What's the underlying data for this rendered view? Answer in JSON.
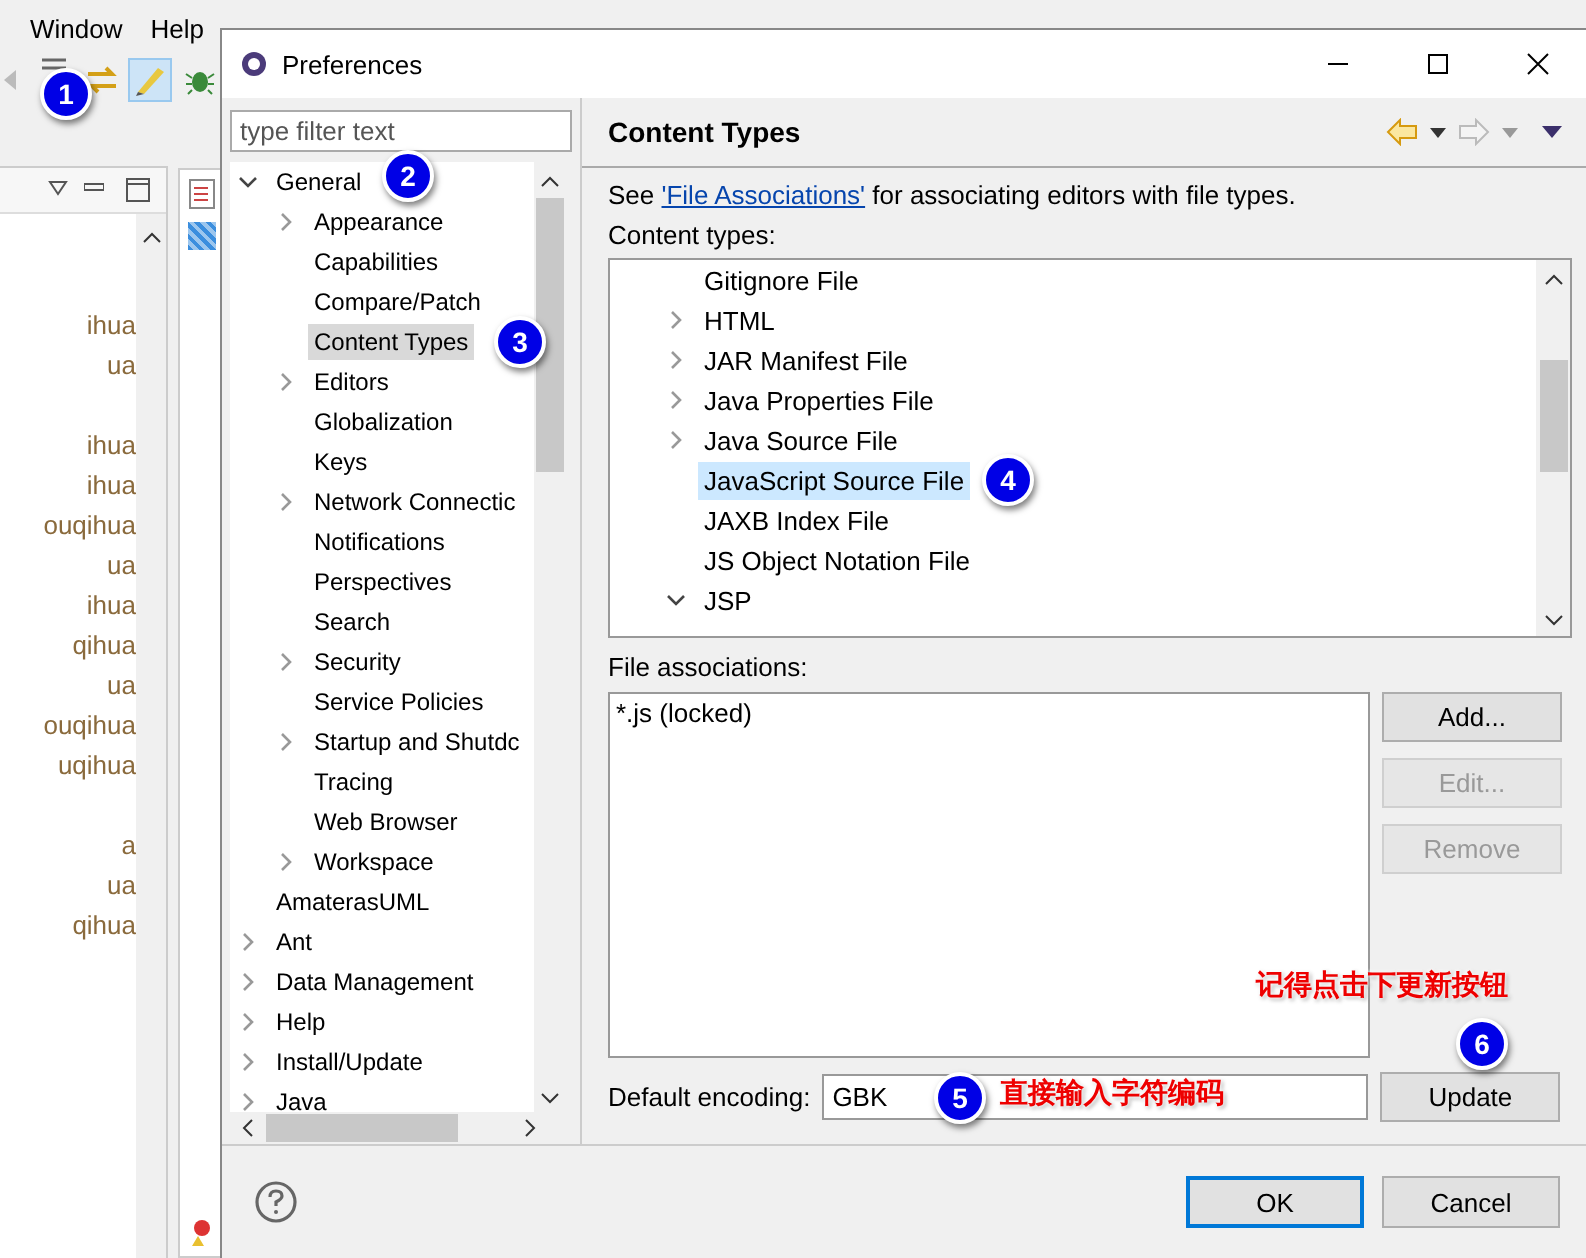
{
  "background_window": {
    "menu": [
      "Window",
      "Help"
    ],
    "view_rows": [
      "ihua",
      "ua",
      "ihua",
      "ihua",
      "ouqihua",
      "ua",
      "ihua",
      "qihua",
      "ua",
      "ouqihua",
      "uqihua",
      "a",
      "ua",
      "qihua"
    ]
  },
  "window": {
    "title": "Preferences"
  },
  "filter": {
    "placeholder": "type filter text"
  },
  "tree": [
    {
      "label": "General",
      "kind": "branch",
      "expanded": true,
      "selected": false,
      "children": [
        {
          "label": "Appearance",
          "kind": "branch",
          "expanded": false,
          "selected": false
        },
        {
          "label": "Capabilities",
          "kind": "leaf",
          "selected": false
        },
        {
          "label": "Compare/Patch",
          "kind": "leaf",
          "selected": false
        },
        {
          "label": "Content Types",
          "kind": "leaf",
          "selected": true
        },
        {
          "label": "Editors",
          "kind": "branch",
          "expanded": false,
          "selected": false
        },
        {
          "label": "Globalization",
          "kind": "leaf",
          "selected": false
        },
        {
          "label": "Keys",
          "kind": "leaf",
          "selected": false
        },
        {
          "label": "Network Connectic",
          "kind": "branch",
          "expanded": false,
          "selected": false
        },
        {
          "label": "Notifications",
          "kind": "leaf",
          "selected": false
        },
        {
          "label": "Perspectives",
          "kind": "leaf",
          "selected": false
        },
        {
          "label": "Search",
          "kind": "leaf",
          "selected": false
        },
        {
          "label": "Security",
          "kind": "branch",
          "expanded": false,
          "selected": false
        },
        {
          "label": "Service Policies",
          "kind": "leaf",
          "selected": false
        },
        {
          "label": "Startup and Shutdc",
          "kind": "branch",
          "expanded": false,
          "selected": false
        },
        {
          "label": "Tracing",
          "kind": "leaf",
          "selected": false
        },
        {
          "label": "Web Browser",
          "kind": "leaf",
          "selected": false
        },
        {
          "label": "Workspace",
          "kind": "branch",
          "expanded": false,
          "selected": false
        }
      ]
    },
    {
      "label": "AmaterasUML",
      "kind": "leaf",
      "selected": false
    },
    {
      "label": "Ant",
      "kind": "branch",
      "expanded": false,
      "selected": false
    },
    {
      "label": "Data Management",
      "kind": "branch",
      "expanded": false,
      "selected": false
    },
    {
      "label": "Help",
      "kind": "branch",
      "expanded": false,
      "selected": false
    },
    {
      "label": "Install/Update",
      "kind": "branch",
      "expanded": false,
      "selected": false
    },
    {
      "label": "Java",
      "kind": "branch",
      "expanded": false,
      "selected": false
    }
  ],
  "page": {
    "title": "Content Types",
    "description_before": "See ",
    "description_link": "'File Associations'",
    "description_after": " for associating editors with file types.",
    "content_types_label": "Content types:",
    "content_types": [
      {
        "label": "Gitignore File",
        "kind": "leaf",
        "selected": false
      },
      {
        "label": "HTML",
        "kind": "branch",
        "expanded": false,
        "selected": false
      },
      {
        "label": "JAR Manifest File",
        "kind": "branch",
        "expanded": false,
        "selected": false
      },
      {
        "label": "Java Properties File",
        "kind": "branch",
        "expanded": false,
        "selected": false
      },
      {
        "label": "Java Source File",
        "kind": "branch",
        "expanded": false,
        "selected": false
      },
      {
        "label": "JavaScript Source File",
        "kind": "leaf",
        "selected": true
      },
      {
        "label": "JAXB Index File",
        "kind": "leaf",
        "selected": false
      },
      {
        "label": "JS Object Notation File",
        "kind": "leaf",
        "selected": false
      },
      {
        "label": "JSP",
        "kind": "branch",
        "expanded": true,
        "selected": false
      }
    ],
    "file_associations_label": "File associations:",
    "file_associations": [
      "*.js (locked)"
    ],
    "side_buttons": [
      {
        "label": "Add...",
        "disabled": false
      },
      {
        "label": "Edit...",
        "disabled": true
      },
      {
        "label": "Remove",
        "disabled": true
      }
    ],
    "encoding_label": "Default encoding:",
    "encoding_value": "GBK",
    "update_button": "Update"
  },
  "footer_buttons": [
    {
      "label": "OK",
      "default": true
    },
    {
      "label": "Cancel",
      "default": false
    }
  ],
  "annotations": [
    "1",
    "2",
    "3",
    "4",
    "5",
    "6"
  ],
  "notes": [
    "记得点击下更新按钮",
    "直接输入字符编码"
  ]
}
